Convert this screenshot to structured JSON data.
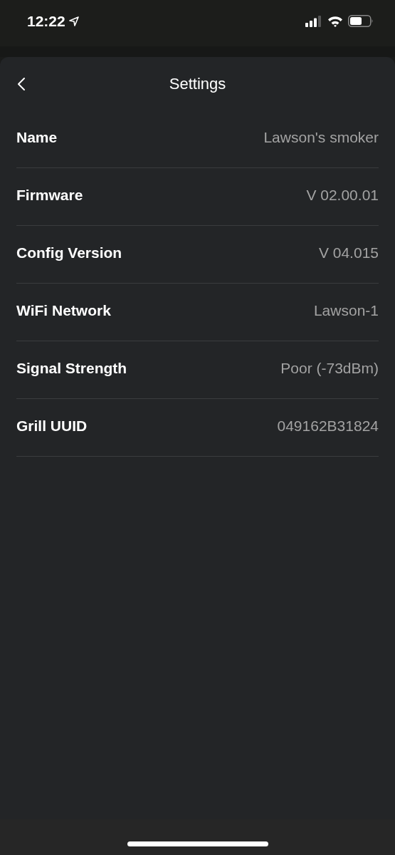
{
  "status_bar": {
    "time": "12:22"
  },
  "header": {
    "title": "Settings"
  },
  "rows": [
    {
      "label": "Name",
      "value": "Lawson's smoker"
    },
    {
      "label": "Firmware",
      "value": "V 02.00.01"
    },
    {
      "label": "Config Version",
      "value": "V 04.015"
    },
    {
      "label": "WiFi Network",
      "value": "Lawson-1"
    },
    {
      "label": "Signal Strength",
      "value": "Poor (-73dBm)"
    },
    {
      "label": "Grill UUID",
      "value": "049162B31824"
    }
  ]
}
